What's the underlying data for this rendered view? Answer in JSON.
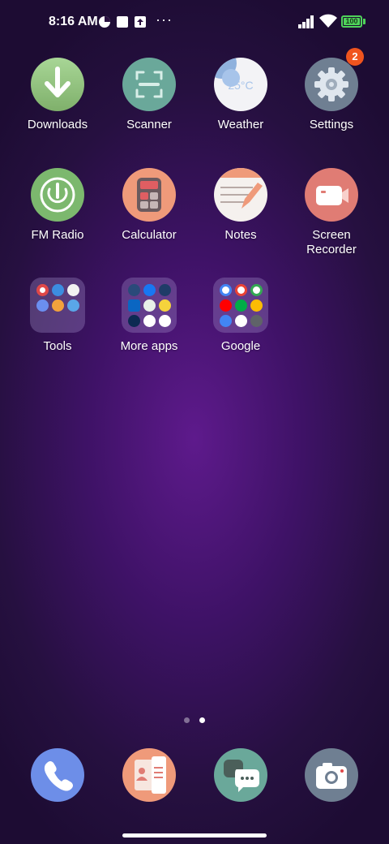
{
  "status_bar": {
    "time": "8:16 AM",
    "battery": "100"
  },
  "apps": [
    {
      "label": "Downloads"
    },
    {
      "label": "Scanner"
    },
    {
      "label": "Weather",
      "temp": "25°C"
    },
    {
      "label": "Settings",
      "badge": "2"
    },
    {
      "label": "FM Radio"
    },
    {
      "label": "Calculator"
    },
    {
      "label": "Notes"
    },
    {
      "label": "Screen Recorder"
    }
  ],
  "folders": [
    {
      "label": "Tools"
    },
    {
      "label": "More apps"
    },
    {
      "label": "Google"
    }
  ],
  "colors": {
    "downloads": "#8fc07e",
    "scanner": "#6aa89a",
    "settings": "#6f7f92",
    "fm_radio": "#7cb86e",
    "calculator": "#ef9a7a",
    "screen_recorder": "#e07c74",
    "phone": "#6d8ee8",
    "contacts": "#ef9a7a",
    "messages": "#6aa89a",
    "camera": "#6f7f92",
    "badge": "#f0541e"
  }
}
